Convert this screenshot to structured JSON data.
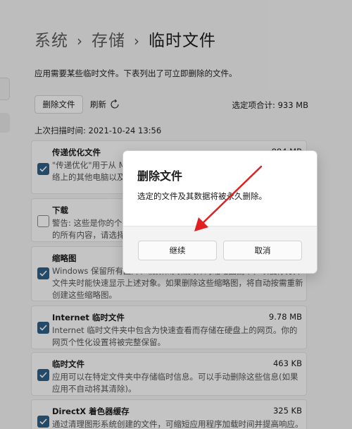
{
  "breadcrumb": {
    "items": [
      "系统",
      "存储",
      "临时文件"
    ],
    "separator": "›"
  },
  "description": "应用需要某些临时文件。下表列出了可立即删除的文件。",
  "toolbar": {
    "remove_label": "删除文件",
    "refresh_label": "刷新",
    "total_label": "选定项合计: 933 MB"
  },
  "last_scan": "上次扫描时间: 2021-10-24 13:56",
  "items": [
    {
      "title": "传递优化文件",
      "size": "884 MB",
      "checked": true,
      "body": "\"传递优化\"用于从 Microsoft 下载更新的文件中，以便上传到本地网络上的其他电脑以及作)。如果你需要空间，可以删除它们。"
    },
    {
      "title": "下载",
      "size": "",
      "checked": false,
      "body": "警告: 这些是你的个人下载文件夹中的文件。如果你想删除此文件夹中的所有内容，请选择此项。"
    },
    {
      "title": "缩略图",
      "size": "",
      "checked": true,
      "body": "Windows 保留所有图片、视频和文档文件的缩略图副本，以便你打开文件夹时能快速显示上述对象。如果删除这些缩略图，将自动按需重新创建这些缩略图。"
    },
    {
      "title": "Internet 临时文件",
      "size": "9.78 MB",
      "checked": true,
      "body": "Internet 临时文件夹中包含为快速查看而存储在硬盘上的网页。你的网页个性化设置将被完整保留。"
    },
    {
      "title": "临时文件",
      "size": "463 KB",
      "checked": true,
      "body": "应用可以在特定文件夹中存储临时信息。可以手动删除这些信息(如果应用不自动将其清除)。"
    },
    {
      "title": "DirectX 着色器缓存",
      "size": "325 KB",
      "checked": true,
      "body": "通过清理图形系统创建的文件，可缩短应用程序加载时间并提高响应。"
    }
  ],
  "dialog": {
    "title": "删除文件",
    "message": "选定的文件及其数据将被永久删除。",
    "continue_label": "继续",
    "cancel_label": "取消"
  },
  "colors": {
    "accent": "#2e5f86",
    "annotation_arrow": "#e02020"
  }
}
